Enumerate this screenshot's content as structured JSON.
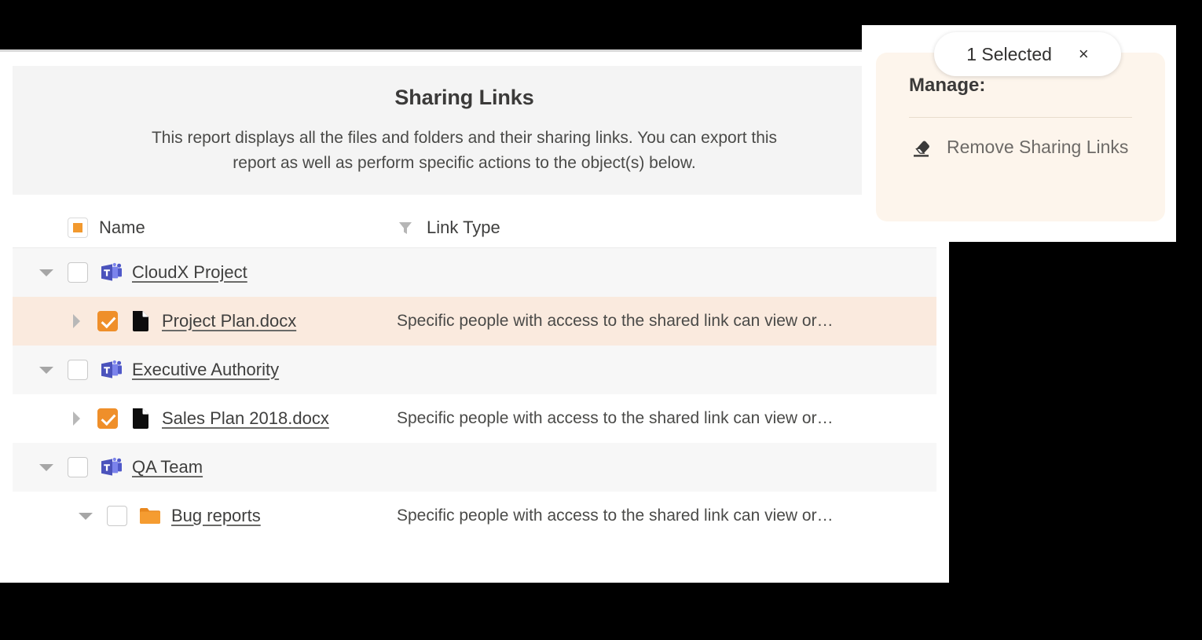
{
  "report": {
    "title": "Sharing Links",
    "description": "This report displays all the files and folders and their sharing links. You can export this report as well as perform specific actions to the object(s) below."
  },
  "table": {
    "columns": {
      "name": "Name",
      "link_type": "Link Type",
      "name_select_all_icon": "indeterminate-checkbox-icon",
      "link_type_filter_icon": "filter-funnel-icon"
    },
    "rows": [
      {
        "name": "CloudX Project",
        "link_type": "",
        "icon": "microsoft-teams-icon",
        "kind": "team",
        "checked": false,
        "expanded": true,
        "twisty": "chevron-down-icon",
        "indent": 0,
        "selected": false
      },
      {
        "name": "Project Plan.docx",
        "link_type": "Specific people with access to the shared link can view or…",
        "icon": "document-file-icon",
        "kind": "file",
        "checked": true,
        "expanded": false,
        "twisty": "chevron-right-icon",
        "indent": 1,
        "selected": true
      },
      {
        "name": "Executive Authority",
        "link_type": "",
        "icon": "microsoft-teams-icon",
        "kind": "team",
        "checked": false,
        "expanded": true,
        "twisty": "chevron-down-icon",
        "indent": 0,
        "selected": false
      },
      {
        "name": "Sales Plan 2018.docx",
        "link_type": "Specific people with access to the shared link can view or…",
        "icon": "document-file-icon",
        "kind": "file",
        "checked": true,
        "expanded": false,
        "twisty": "chevron-right-icon",
        "indent": 1,
        "selected": false
      },
      {
        "name": "QA Team",
        "link_type": "",
        "icon": "microsoft-teams-icon",
        "kind": "team",
        "checked": false,
        "expanded": true,
        "twisty": "chevron-down-icon",
        "indent": 0,
        "selected": false
      },
      {
        "name": "Bug reports",
        "link_type": "Specific people with access to the shared link can view or…",
        "icon": "folder-icon",
        "kind": "folder",
        "checked": false,
        "expanded": true,
        "twisty": "chevron-down-icon",
        "indent": 2,
        "selected": false
      }
    ]
  },
  "action_panel": {
    "selected_count_label": "1 Selected",
    "close_label": "×",
    "close_icon": "close-icon",
    "manage_title": "Manage:",
    "actions": [
      {
        "label": "Remove Sharing Links",
        "icon": "eraser-icon"
      }
    ]
  },
  "colors": {
    "accent_orange": "#ef8f2a",
    "teams_purple": "#5059c9",
    "selected_row": "#faeade",
    "group_row": "#f7f7f7",
    "header_box": "#f4f4f4",
    "card_bg": "#fdf5ec",
    "text": "#3f3f3e",
    "backdrop": "#000000"
  }
}
